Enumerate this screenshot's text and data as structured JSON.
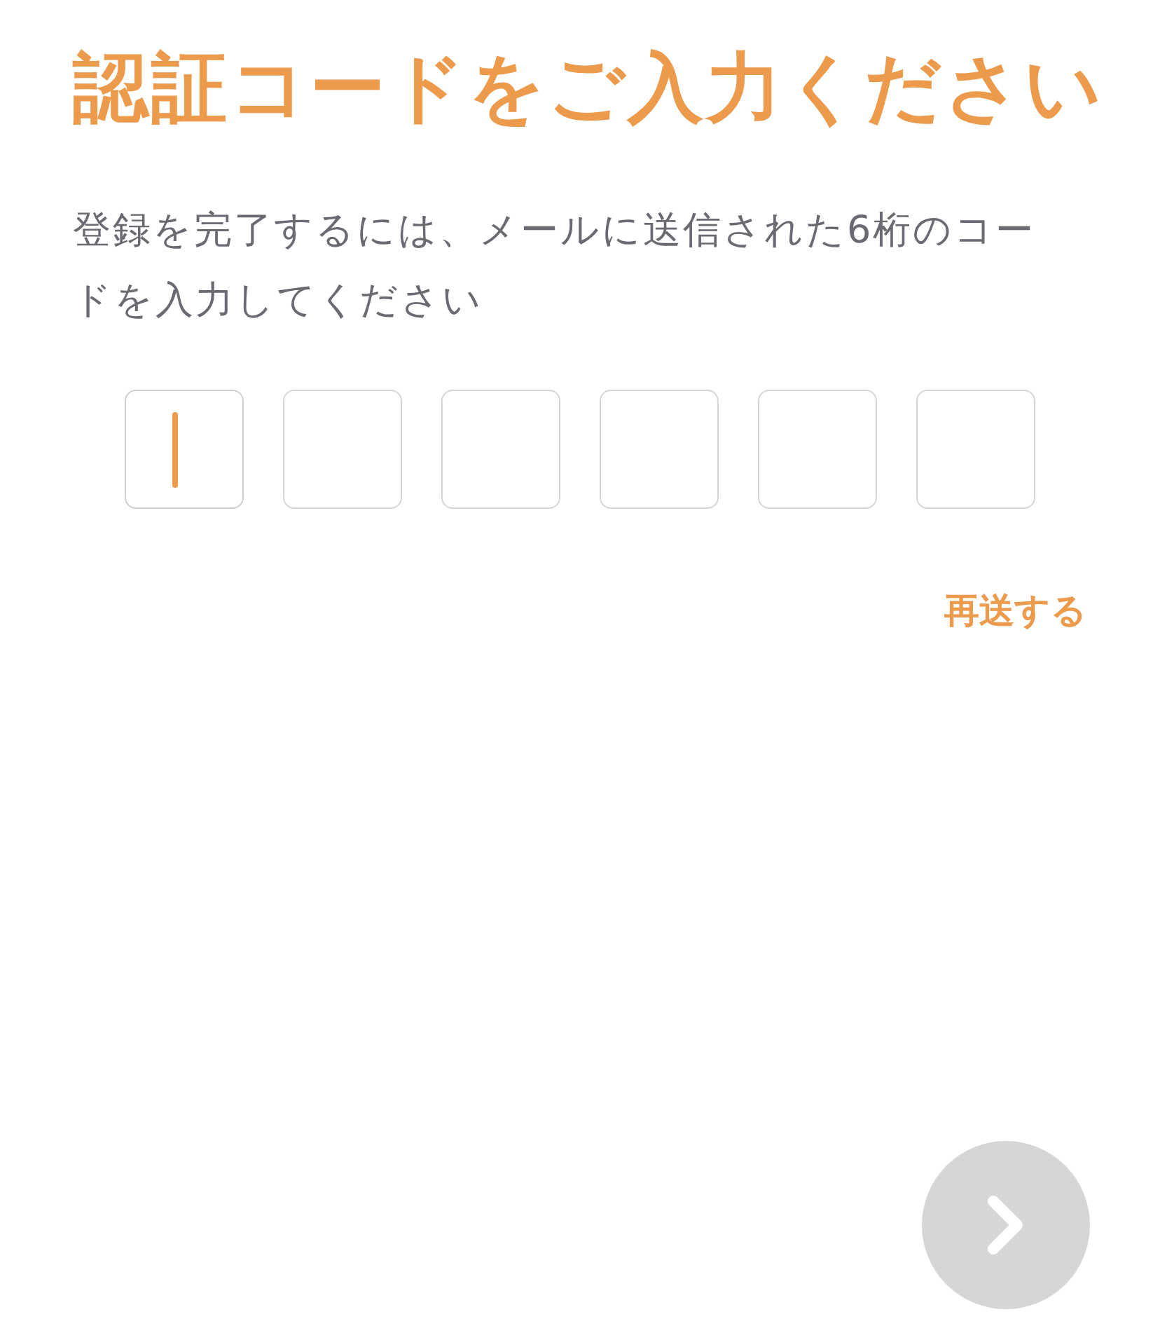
{
  "title": "認証コードをご入力ください",
  "description": "登録を完了するには、メールに送信された6桁のコードを入力してください",
  "code_boxes": [
    {
      "focused": true
    },
    {
      "focused": false
    },
    {
      "focused": false
    },
    {
      "focused": false
    },
    {
      "focused": false
    },
    {
      "focused": false
    }
  ],
  "resend_link": "再送する",
  "next_button": {
    "disabled": true
  }
}
